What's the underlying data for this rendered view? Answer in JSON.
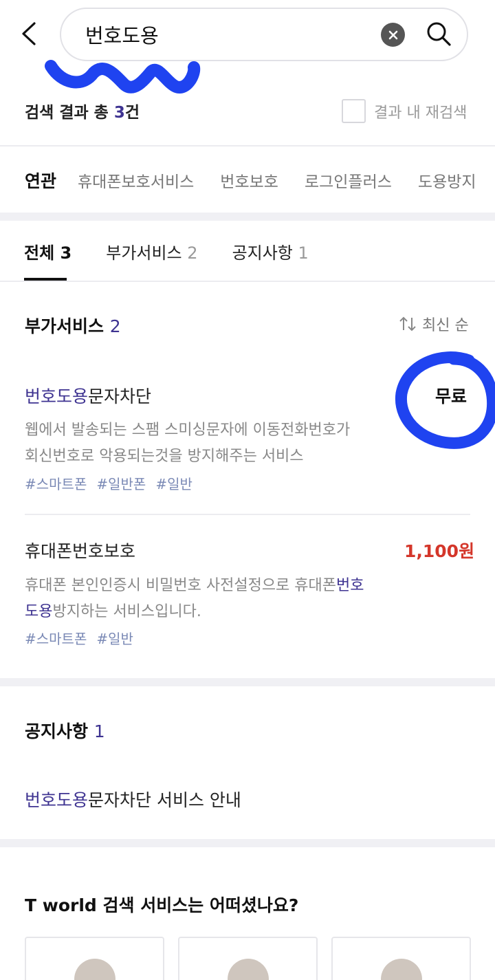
{
  "header": {
    "search_value": "번호도용",
    "back_icon": "chevron-left-icon",
    "clear_icon": "clear-icon",
    "search_icon": "search-icon"
  },
  "result_summary": {
    "prefix": "검색 결과 총 ",
    "count": "3",
    "suffix": "건",
    "re_search_label": "결과 내 재검색"
  },
  "related": {
    "title": "연관",
    "items": [
      "휴대폰보호서비스",
      "번호보호",
      "로그인플러스",
      "도용방지"
    ]
  },
  "tabs": [
    {
      "label": "전체",
      "count": "3"
    },
    {
      "label": "부가서비스",
      "count": "2"
    },
    {
      "label": "공지사항",
      "count": "1"
    }
  ],
  "addon_section": {
    "title": "부가서비스",
    "count": "2",
    "sort_label": "최신 순",
    "items": [
      {
        "title_highlight": "번호도용",
        "title_rest": "문자차단",
        "price": "무료",
        "desc_line1": "웹에서 발송되는 스팸 스미싱문자에 이동전화번호가",
        "desc_line2": "회신번호로 악용되는것을 방지해주는 서비스",
        "tags": [
          "#스마트폰",
          "#일반폰",
          "#일반"
        ]
      },
      {
        "title": "휴대폰번호보호",
        "price": "1,100원",
        "desc_line1_plain": "휴대폰 본인인증시 비밀번호 사전설정으로 휴대폰",
        "desc_line1_hl": "번호",
        "desc_line2_hl": "도용",
        "desc_line2_plain": "방지하는 서비스입니다.",
        "tags": [
          "#스마트폰",
          "#일반"
        ]
      }
    ]
  },
  "notice_section": {
    "title": "공지사항",
    "count": "1",
    "item_highlight": "번호도용",
    "item_rest": "문자차단 서비스 안내"
  },
  "feedback": {
    "title": "T world 검색 서비스는 어떠셨나요?"
  },
  "colors": {
    "accent": "#3e3391",
    "price_red": "#d4362a",
    "annotation_blue": "#1f43f0"
  }
}
